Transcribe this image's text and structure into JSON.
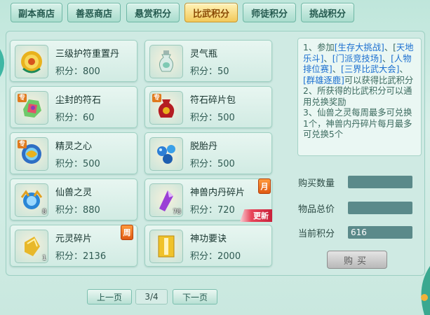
{
  "tabs": [
    {
      "label": "副本商店",
      "active": false
    },
    {
      "label": "善恶商店",
      "active": false
    },
    {
      "label": "悬赏积分",
      "active": false
    },
    {
      "label": "比武积分",
      "active": true
    },
    {
      "label": "师徒积分",
      "active": false
    },
    {
      "label": "挑战积分",
      "active": false
    }
  ],
  "score_prefix": "积分：",
  "items": [
    {
      "name": "三级护符重置丹",
      "score": "800",
      "icon": "gold-flower-pill-icon"
    },
    {
      "name": "灵气瓶",
      "score": "50",
      "icon": "jade-vase-icon"
    },
    {
      "name": "尘封的符石",
      "score": "60",
      "icon": "rune-stone-icon",
      "tag": "专"
    },
    {
      "name": "符石碎片包",
      "score": "500",
      "icon": "red-pouch-icon",
      "tag": "专"
    },
    {
      "name": "精灵之心",
      "score": "500",
      "icon": "spirit-heart-icon",
      "tag": "专"
    },
    {
      "name": "脱胎丹",
      "score": "500",
      "icon": "blue-pills-icon"
    },
    {
      "name": "仙兽之灵",
      "score": "880",
      "icon": "beast-orb-icon",
      "count": "8"
    },
    {
      "name": "神兽内丹碎片",
      "score": "720",
      "icon": "purple-shard-icon",
      "count": "78",
      "cycle": "月",
      "new": "更新"
    },
    {
      "name": "元灵碎片",
      "score": "2136",
      "icon": "gold-fragment-icon",
      "count": "1",
      "cycle": "周"
    },
    {
      "name": "神功要诀",
      "score": "2000",
      "icon": "yellow-book-icon"
    }
  ],
  "info": {
    "l1a": "1、参加",
    "l1b": "[生存大挑战]",
    "l1c": "、[",
    "l1d": "天地乐斗]",
    "l1e": "、",
    "l1f": "[门派竞技场]",
    "l1g": "、",
    "l1h": "[人物排位赛]",
    "l1i": "、",
    "l1j": "[三界比武大会]",
    "l1k": "、",
    "l1l": "[群雄逐鹿]",
    "l1m": "可以获得比武积分",
    "l2": "2、所获得的比武积分可以通用兑换奖励",
    "l3": "3、仙兽之灵每周最多可兑换1个，神兽内丹碎片每月最多可兑换5个"
  },
  "purchase": {
    "qty_label": "购买数量",
    "qty_value": "",
    "total_label": "物品总价",
    "total_value": "",
    "current_label": "当前积分",
    "current_value": "616",
    "buy_label": "购买"
  },
  "pager": {
    "prev": "上一页",
    "page": "3/4",
    "next": "下一页"
  }
}
